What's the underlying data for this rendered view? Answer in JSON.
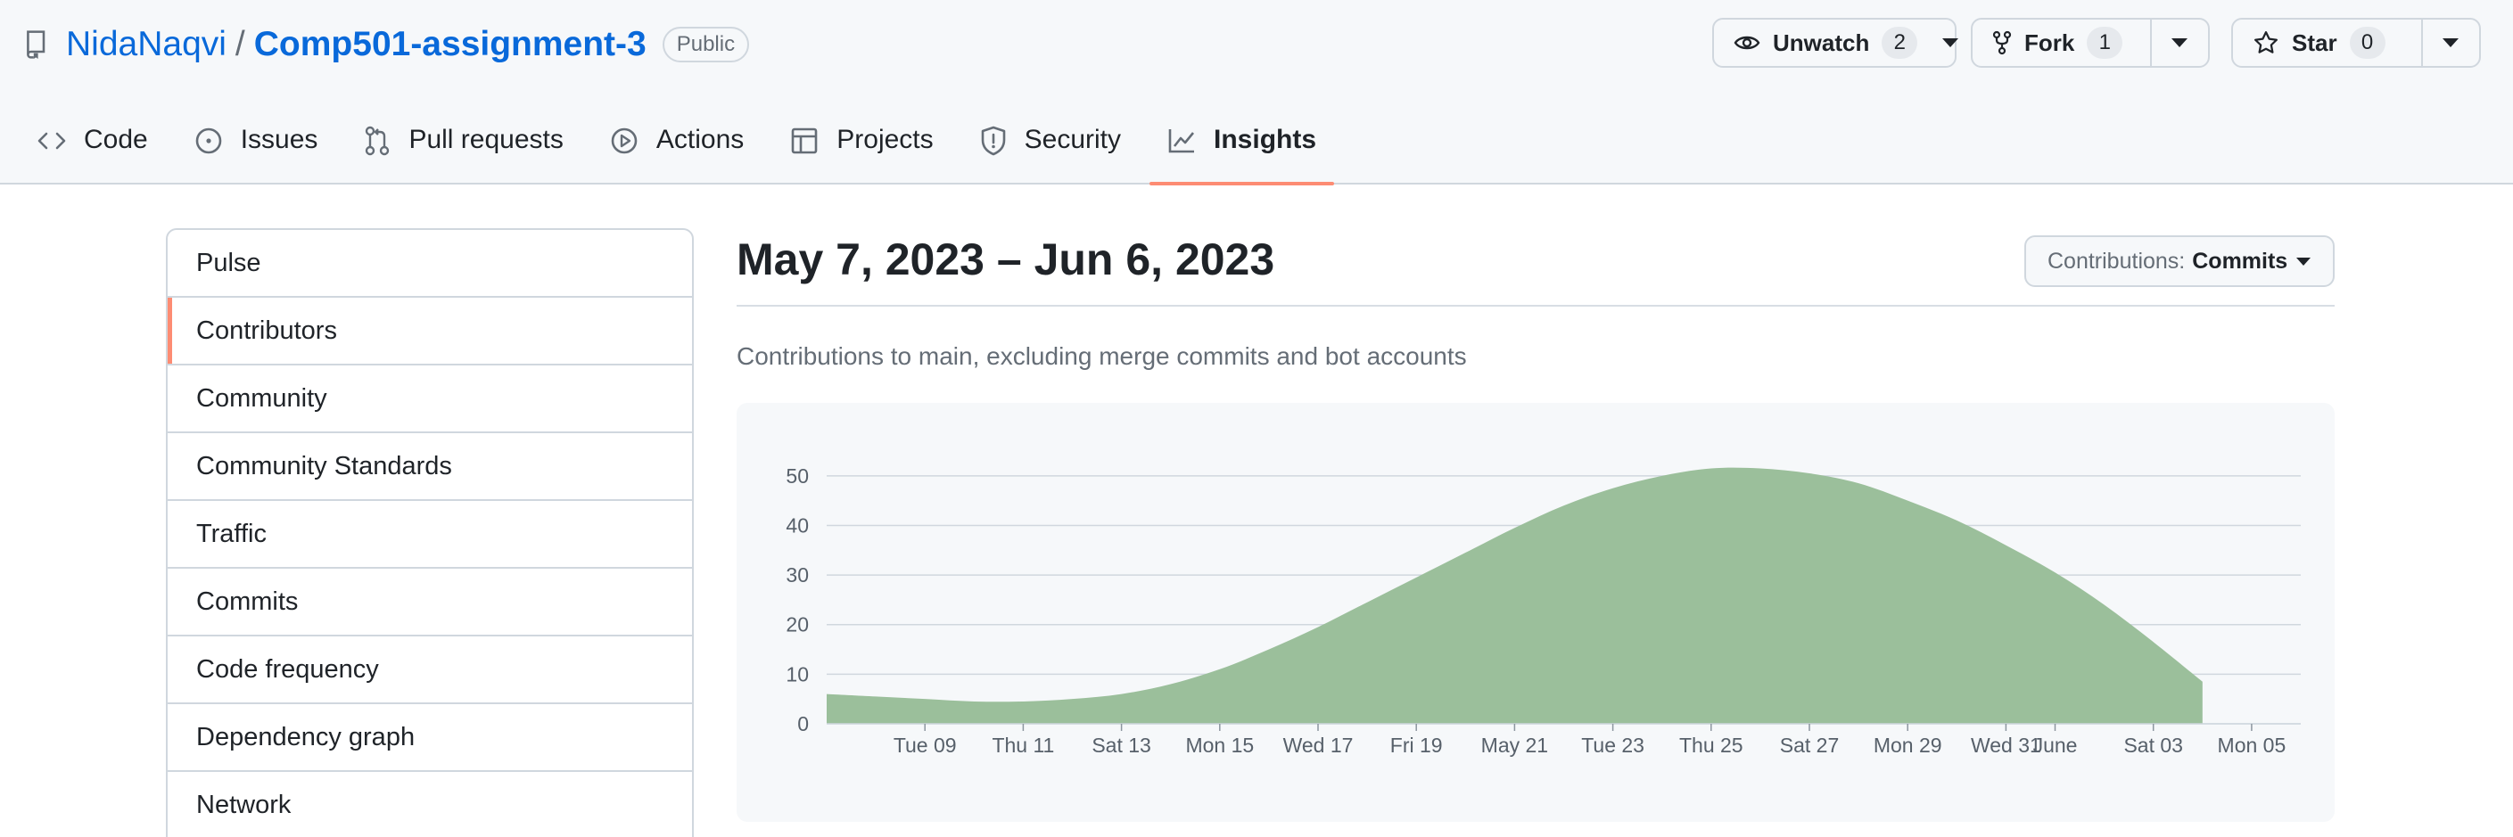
{
  "repo": {
    "owner": "NidaNaqvi",
    "separator": "/",
    "name": "Comp501-assignment-3",
    "visibility": "Public"
  },
  "actions": {
    "watch": {
      "label": "Unwatch",
      "count": "2",
      "icon": "eye-icon"
    },
    "fork": {
      "label": "Fork",
      "count": "1",
      "icon": "fork-icon"
    },
    "star": {
      "label": "Star",
      "count": "0",
      "icon": "star-icon"
    }
  },
  "tabs": [
    {
      "label": "Code",
      "icon": "code-icon"
    },
    {
      "label": "Issues",
      "icon": "issue-icon"
    },
    {
      "label": "Pull requests",
      "icon": "pull-request-icon"
    },
    {
      "label": "Actions",
      "icon": "play-icon"
    },
    {
      "label": "Projects",
      "icon": "table-icon"
    },
    {
      "label": "Security",
      "icon": "shield-icon"
    },
    {
      "label": "Insights",
      "icon": "graph-icon",
      "active": true
    }
  ],
  "sidebar": {
    "items": [
      {
        "label": "Pulse"
      },
      {
        "label": "Contributors",
        "active": true
      },
      {
        "label": "Community"
      },
      {
        "label": "Community Standards"
      },
      {
        "label": "Traffic"
      },
      {
        "label": "Commits"
      },
      {
        "label": "Code frequency"
      },
      {
        "label": "Dependency graph"
      },
      {
        "label": "Network"
      }
    ]
  },
  "main": {
    "date_range": "May 7, 2023 – Jun 6, 2023",
    "contributions_select": {
      "prefix": "Contributions:",
      "value": "Commits"
    },
    "subtitle": "Contributions to main, excluding merge commits and bot accounts"
  },
  "colors": {
    "accent_tab": "#fd8c73",
    "link": "#0969da",
    "area_fill": "#9bbf9b"
  },
  "chart_data": {
    "type": "area",
    "x": [
      "2023-05-07",
      "2023-05-08",
      "2023-05-09",
      "2023-05-10",
      "2023-05-11",
      "2023-05-12",
      "2023-05-13",
      "2023-05-14",
      "2023-05-15",
      "2023-05-16",
      "2023-05-17",
      "2023-05-18",
      "2023-05-19",
      "2023-05-20",
      "2023-05-21",
      "2023-05-22",
      "2023-05-23",
      "2023-05-24",
      "2023-05-25",
      "2023-05-26",
      "2023-05-27",
      "2023-05-28",
      "2023-05-29",
      "2023-05-30",
      "2023-05-31",
      "2023-06-01",
      "2023-06-02",
      "2023-06-03",
      "2023-06-04"
    ],
    "series": [
      {
        "values": [
          6,
          5.5,
          5,
          4.5,
          4.5,
          5,
          6,
          8,
          11,
          15,
          19.5,
          24.5,
          29.5,
          34.5,
          39.5,
          44,
          47.5,
          50,
          51.5,
          51.5,
          50.5,
          48.5,
          45,
          41,
          36,
          30.5,
          24,
          16.5,
          8.5
        ]
      }
    ],
    "y_ticks": [
      "0",
      "10",
      "20",
      "30",
      "40",
      "50"
    ],
    "ylim": [
      0,
      55
    ],
    "x_tick_labels": [
      {
        "date": "2023-05-09",
        "label": "Tue 09"
      },
      {
        "date": "2023-05-11",
        "label": "Thu 11"
      },
      {
        "date": "2023-05-13",
        "label": "Sat 13"
      },
      {
        "date": "2023-05-15",
        "label": "Mon 15"
      },
      {
        "date": "2023-05-17",
        "label": "Wed 17"
      },
      {
        "date": "2023-05-19",
        "label": "Fri 19"
      },
      {
        "date": "2023-05-21",
        "label": "May 21"
      },
      {
        "date": "2023-05-23",
        "label": "Tue 23"
      },
      {
        "date": "2023-05-25",
        "label": "Thu 25"
      },
      {
        "date": "2023-05-27",
        "label": "Sat 27"
      },
      {
        "date": "2023-05-29",
        "label": "Mon 29"
      },
      {
        "date": "2023-05-31",
        "label": "Wed 31"
      },
      {
        "date": "2023-06-01",
        "label": "June"
      },
      {
        "date": "2023-06-03",
        "label": "Sat 03"
      },
      {
        "date": "2023-06-05",
        "label": "Mon 05"
      }
    ],
    "x_range": [
      "2023-05-07",
      "2023-06-06"
    ],
    "grid": true,
    "legend": "none"
  }
}
